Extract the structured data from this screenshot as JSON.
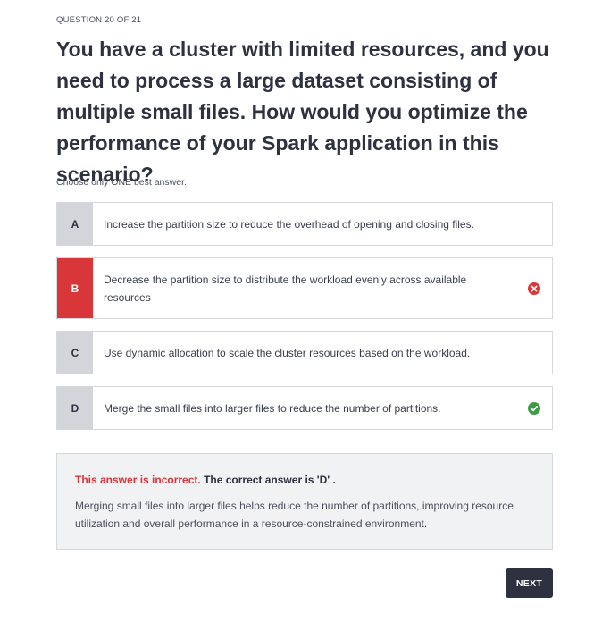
{
  "question": {
    "counter": "QUESTION 20 OF 21",
    "text": "You have a cluster with limited resources, and you need to process a large dataset consisting of multiple small files. How would you optimize the performance of your Spark application in this scenario?",
    "instruction": "Choose only ONE best answer."
  },
  "options": [
    {
      "letter": "A",
      "text": "Increase the partition size to reduce the overhead of opening and closing files."
    },
    {
      "letter": "B",
      "text": "Decrease the partition size to distribute the workload evenly across available resources",
      "status": "selected-incorrect",
      "icon": "error-circle-icon"
    },
    {
      "letter": "C",
      "text": "Use dynamic allocation to scale the cluster resources based on the workload."
    },
    {
      "letter": "D",
      "text": "Merge the small files into larger files to reduce the number of partitions.",
      "status": "correct",
      "icon": "check-circle-icon"
    }
  ],
  "feedback": {
    "incorrect_label": "This answer is incorrect.",
    "correct_answer": "The correct answer is 'D' .",
    "explanation": "Merging small files into larger files helps reduce the number of partitions, improving resource utilization and overall performance in a resource-constrained environment."
  },
  "next_label": "NEXT",
  "colors": {
    "incorrect": "#d9363a",
    "correct": "#3d9a45",
    "letter_bg": "#d3d5db",
    "button_bg": "#2e3240"
  }
}
